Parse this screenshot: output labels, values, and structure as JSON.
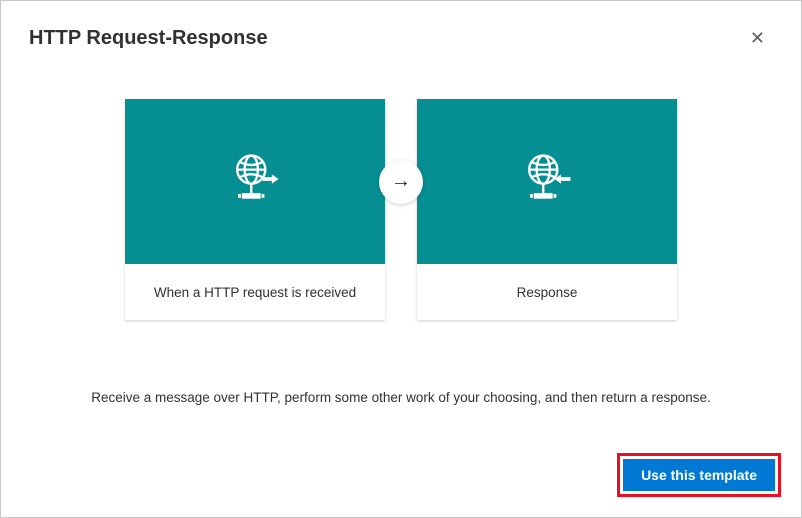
{
  "dialog": {
    "title": "HTTP Request-Response",
    "description": "Receive a message over HTTP, perform some other work of your choosing, and then return a response."
  },
  "cards": [
    {
      "label": "When a HTTP request is received",
      "icon": "http-request-icon"
    },
    {
      "label": "Response",
      "icon": "http-response-icon"
    }
  ],
  "buttons": {
    "use_template": "Use this template"
  },
  "colors": {
    "accent": "#0078d4",
    "tile": "#058f92",
    "highlight": "#e81123"
  }
}
